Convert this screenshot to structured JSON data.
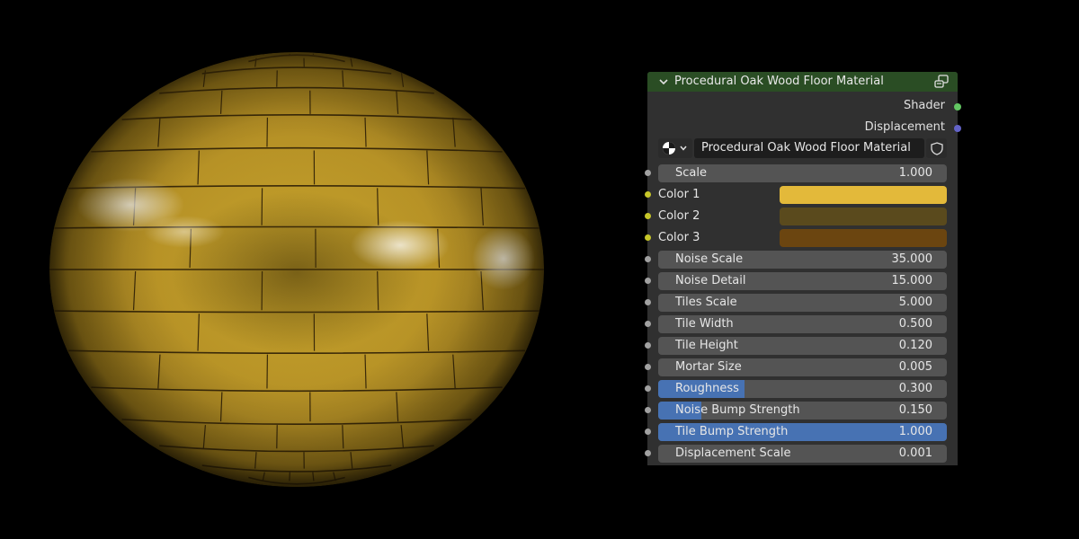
{
  "node": {
    "title": "Procedural Oak Wood Floor Material",
    "header_color": "#2a4d24",
    "outputs": [
      {
        "label": "Shader",
        "socket_color": "#63c763"
      },
      {
        "label": "Displacement",
        "socket_color": "#6363c7"
      }
    ],
    "material_name": "Procedural Oak Wood Floor Material",
    "icons": {
      "collapse": "chevron-down-icon",
      "node_group": "node-group-icon",
      "material_type": "material-sphere-icon",
      "fake_user": "shield-icon"
    },
    "inputs": {
      "scale": {
        "label": "Scale",
        "value": "1.000"
      },
      "color1": {
        "label": "Color 1",
        "color": "#e3b93a"
      },
      "color2": {
        "label": "Color 2",
        "color": "#5a4a1d"
      },
      "color3": {
        "label": "Color 3",
        "color": "#6b4510"
      },
      "noise_scale": {
        "label": "Noise Scale",
        "value": "35.000"
      },
      "noise_detail": {
        "label": "Noise Detail",
        "value": "15.000"
      },
      "tiles_scale": {
        "label": "Tiles Scale",
        "value": "5.000"
      },
      "tile_width": {
        "label": "Tile Width",
        "value": "0.500"
      },
      "tile_height": {
        "label": "Tile Height",
        "value": "0.120"
      },
      "mortar_size": {
        "label": "Mortar Size",
        "value": "0.005"
      },
      "roughness": {
        "label": "Roughness",
        "value": "0.300",
        "fill": 0.3
      },
      "noise_bump": {
        "label": "Noise Bump Strength",
        "value": "0.150",
        "fill": 0.15
      },
      "tile_bump": {
        "label": "Tile Bump Strength",
        "value": "1.000",
        "fill": 1.0
      },
      "displacement_scale": {
        "label": "Displacement Scale",
        "value": "0.001"
      }
    }
  }
}
